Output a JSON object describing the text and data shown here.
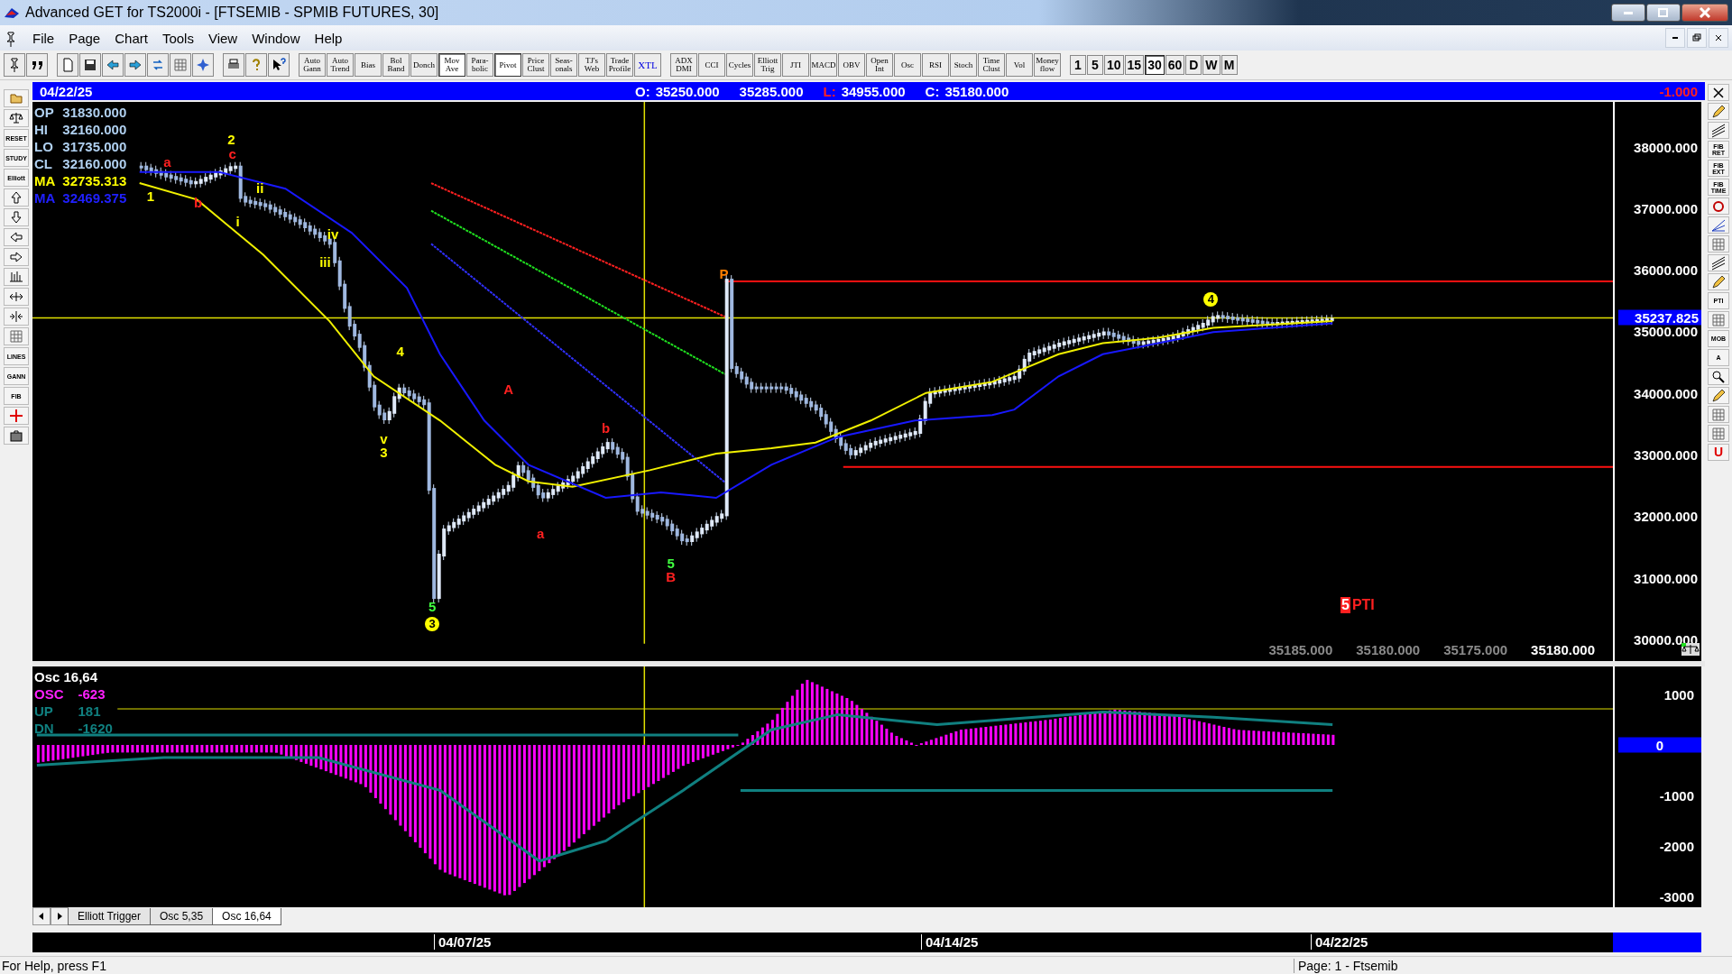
{
  "window": {
    "title": "Advanced GET for TS2000i - [FTSEMIB - SPMIB FUTURES, 30]"
  },
  "menu": [
    "File",
    "Page",
    "Chart",
    "Tools",
    "View",
    "Window",
    "Help"
  ],
  "toolbar": {
    "icon_buttons": [
      {
        "kind": "pin"
      },
      {
        "kind": "quote"
      },
      {
        "kind": "page"
      },
      {
        "kind": "save"
      },
      {
        "kind": "back"
      },
      {
        "kind": "forward"
      },
      {
        "kind": "sync"
      },
      {
        "kind": "grid"
      },
      {
        "kind": "star"
      },
      {
        "kind": "print"
      },
      {
        "kind": "help"
      },
      {
        "kind": "whatsthis"
      }
    ],
    "study_buttons": [
      {
        "label": "Auto Gann",
        "pressed": false
      },
      {
        "label": "Auto Trend",
        "pressed": false
      },
      {
        "label": "Bias",
        "pressed": false
      },
      {
        "label": "Bol Band",
        "pressed": false
      },
      {
        "label": "Donch",
        "pressed": false
      },
      {
        "label": "Mov Ave",
        "pressed": true
      },
      {
        "label": "Para-bolic",
        "pressed": false
      },
      {
        "label": "Pivot",
        "pressed": true
      },
      {
        "label": "Price Clust",
        "pressed": false
      },
      {
        "label": "Seas-onals",
        "pressed": false
      },
      {
        "label": "TJ's Web",
        "pressed": false
      },
      {
        "label": "Trade Profile",
        "pressed": false
      },
      {
        "label": "XTL",
        "pressed": false
      }
    ],
    "indicator_buttons": [
      {
        "label": "ADX DMI",
        "pressed": false
      },
      {
        "label": "CCI",
        "pressed": false
      },
      {
        "label": "Cycles",
        "pressed": false
      },
      {
        "label": "Elliott Trig",
        "pressed": false
      },
      {
        "label": "JTI",
        "pressed": false
      },
      {
        "label": "MACD",
        "pressed": false
      },
      {
        "label": "OBV",
        "pressed": false
      },
      {
        "label": "Open Int",
        "pressed": false
      },
      {
        "label": "Osc",
        "pressed": false
      },
      {
        "label": "RSI",
        "pressed": false
      },
      {
        "label": "Stoch",
        "pressed": false
      },
      {
        "label": "Time Clust",
        "pressed": false
      },
      {
        "label": "Vol",
        "pressed": false
      },
      {
        "label": "Money flow",
        "pressed": false
      }
    ],
    "intervals": [
      {
        "label": "1",
        "selected": false
      },
      {
        "label": "5",
        "selected": false
      },
      {
        "label": "10",
        "selected": false
      },
      {
        "label": "15",
        "selected": false
      },
      {
        "label": "30",
        "selected": true
      },
      {
        "label": "60",
        "selected": false
      },
      {
        "label": "D",
        "selected": false
      },
      {
        "label": "W",
        "selected": false
      },
      {
        "label": "M",
        "selected": false
      }
    ]
  },
  "left_tools": [
    {
      "kind": "folder"
    },
    {
      "kind": "scales"
    },
    {
      "kind": "label",
      "label": "RESET"
    },
    {
      "kind": "label",
      "label": "STUDY"
    },
    {
      "kind": "label",
      "label": "Elliott"
    },
    {
      "kind": "up"
    },
    {
      "kind": "down"
    },
    {
      "kind": "left"
    },
    {
      "kind": "right"
    },
    {
      "kind": "bars"
    },
    {
      "kind": "expand"
    },
    {
      "kind": "squeeze"
    },
    {
      "kind": "grid"
    },
    {
      "kind": "label",
      "label": "LINES"
    },
    {
      "kind": "label",
      "label": "GANN"
    },
    {
      "kind": "label",
      "label": "FIB"
    },
    {
      "kind": "cross"
    },
    {
      "kind": "case"
    }
  ],
  "right_tools": [
    {
      "kind": "close"
    },
    {
      "kind": "pencil"
    },
    {
      "kind": "lines"
    },
    {
      "kind": "label",
      "label": "FIB RET"
    },
    {
      "kind": "label",
      "label": "FIB EXT"
    },
    {
      "kind": "label",
      "label": "FIB TIME"
    },
    {
      "kind": "circle"
    },
    {
      "kind": "fan"
    },
    {
      "kind": "grid"
    },
    {
      "kind": "lines"
    },
    {
      "kind": "pencil"
    },
    {
      "kind": "label",
      "label": "PTI"
    },
    {
      "kind": "grid"
    },
    {
      "kind": "label",
      "label": "MOB"
    },
    {
      "kind": "label",
      "label": "A"
    },
    {
      "kind": "zoom"
    },
    {
      "kind": "pencil"
    },
    {
      "kind": "grid"
    },
    {
      "kind": "grid"
    },
    {
      "kind": "magnet",
      "label": "U"
    }
  ],
  "header": {
    "date": "04/22/25",
    "fields": [
      {
        "label": "O:",
        "value": "35250.000",
        "kind": "normal"
      },
      {
        "value": "35285.000",
        "kind": "normal"
      },
      {
        "label": "L:",
        "value": "34955.000",
        "kind": "low"
      },
      {
        "label": "C:",
        "value": "35180.000",
        "kind": "normal"
      }
    ],
    "change": "-1.000"
  },
  "price_legend": [
    {
      "label": "OP",
      "value": "31830.000",
      "kind": "ohlc"
    },
    {
      "label": "HI",
      "value": "32160.000",
      "kind": "ohlc"
    },
    {
      "label": "LO",
      "value": "31735.000",
      "kind": "ohlc"
    },
    {
      "label": "CL",
      "value": "32160.000",
      "kind": "ohlc"
    },
    {
      "label": "MA",
      "value": "32735.313",
      "kind": "ma_fast"
    },
    {
      "label": "MA",
      "value": "32469.375",
      "kind": "ma_slow"
    }
  ],
  "wave_labels": [
    {
      "text": "1",
      "color": "#ffff00",
      "kind": "plain"
    },
    {
      "text": "a",
      "color": "#ff2020",
      "kind": "plain"
    },
    {
      "text": "b",
      "color": "#ff2020",
      "kind": "plain"
    },
    {
      "text": "2",
      "color": "#ffff00",
      "kind": "plain"
    },
    {
      "text": "c",
      "color": "#ff2020",
      "kind": "plain"
    },
    {
      "text": "i",
      "color": "#ffff00",
      "kind": "plain"
    },
    {
      "text": "ii",
      "color": "#ffff00",
      "kind": "plain"
    },
    {
      "text": "iv",
      "color": "#ffff00",
      "kind": "plain"
    },
    {
      "text": "iii",
      "color": "#ffff00",
      "kind": "plain"
    },
    {
      "text": "4",
      "color": "#ffff00",
      "kind": "plain"
    },
    {
      "text": "v",
      "color": "#ffff00",
      "kind": "plain"
    },
    {
      "text": "3",
      "color": "#ffff00",
      "kind": "plain"
    },
    {
      "text": "A",
      "color": "#ff2020",
      "kind": "plain"
    },
    {
      "text": "a",
      "color": "#ff2020",
      "kind": "plain"
    },
    {
      "text": "b",
      "color": "#ff2020",
      "kind": "plain"
    },
    {
      "text": "5",
      "color": "#40ff40",
      "kind": "plain"
    },
    {
      "text": "3",
      "color": "#ffff00",
      "kind": "circled"
    },
    {
      "text": "5",
      "color": "#40ff40",
      "kind": "plain"
    },
    {
      "text": "B",
      "color": "#ff2020",
      "kind": "plain"
    },
    {
      "text": "P",
      "color": "#ff8000",
      "kind": "plain"
    },
    {
      "text": "4",
      "color": "#ffff00",
      "kind": "circled"
    }
  ],
  "pti": {
    "count": "5",
    "label": "PTI"
  },
  "recent_closes": [
    {
      "text": "35185.000",
      "kind": "recent"
    },
    {
      "text": "35180.000",
      "kind": "recent"
    },
    {
      "text": "35175.000",
      "kind": "recent"
    },
    {
      "text": "35180.000",
      "kind": "last"
    }
  ],
  "price_axis": {
    "ticks": [
      "38000.000",
      "37000.000",
      "36000.000",
      "35000.000",
      "34000.000",
      "33000.000",
      "32000.000",
      "31000.000",
      "30000.000"
    ],
    "current": "35237.825"
  },
  "oscillator": {
    "legend": [
      {
        "label": "Osc 16,64",
        "kind": "title"
      },
      {
        "label": "OSC",
        "value": "-623",
        "kind": "osc"
      },
      {
        "label": "UP",
        "value": "181",
        "kind": "band"
      },
      {
        "label": "DN",
        "value": "-1620",
        "kind": "band"
      }
    ],
    "ticks": [
      {
        "text": "1000",
        "kind": "tick"
      },
      {
        "text": "0",
        "kind": "current"
      },
      {
        "text": "-1000",
        "kind": "tick"
      },
      {
        "text": "-2000",
        "kind": "tick"
      },
      {
        "text": "-3000",
        "kind": "tick"
      }
    ]
  },
  "tabs": [
    {
      "label": "Elliott Trigger",
      "selected": false
    },
    {
      "label": "Osc 5,35",
      "selected": false
    },
    {
      "label": "Osc 16,64",
      "selected": true
    }
  ],
  "dates": [
    "04/07/25",
    "04/14/25",
    "04/22/25"
  ],
  "status_bar": {
    "help": "For Help, press F1",
    "page": "Page: 1 - Ftsemib"
  }
}
